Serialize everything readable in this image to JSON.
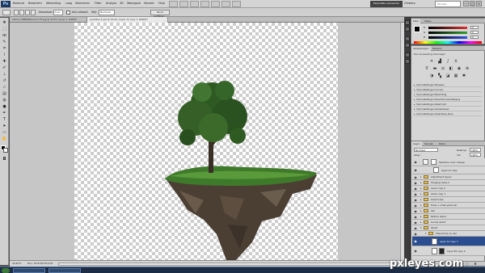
{
  "app": {
    "logo": "Ps"
  },
  "menubar": {
    "items": [
      "Bestand",
      "Bewerken",
      "Afbeelding",
      "Laag",
      "Selecteren",
      "Filter",
      "Analyse",
      "3D",
      "Weergave",
      "Venster",
      "Help"
    ],
    "workspace_button": "Essentiële elementen",
    "workspace_label": "Ontwerp",
    "search_placeholder": "CS Live"
  },
  "options_bar": {
    "feather_label": "Doezelaar:",
    "feather_value": "0 px",
    "antialias_label": "Anti-aliased",
    "style_label": "Stijl:",
    "style_value": "Normaal",
    "refine_button": "Rand verfijnen..."
  },
  "doc_tabs": [
    {
      "label": "ehland_388688/byns-III-75.jpg @ 34,3% (Layer 1, RGB/8)",
      "active": false
    },
    {
      "label": "pixeltiles-3.psd @ 16,6% (Layer 14 copy 7, RGB/8*)",
      "active": true
    }
  ],
  "status": {
    "zoom": "16,67%",
    "doc": "Doc: 43,8 M/133,9 M"
  },
  "color_panel": {
    "tabs": [
      "Kleur",
      "Stalen"
    ],
    "sliders": [
      {
        "label": "R",
        "value": "0",
        "color": "#e03030"
      },
      {
        "label": "G",
        "value": "0",
        "color": "#30a030"
      },
      {
        "label": "B",
        "value": "0",
        "color": "#3050e0"
      }
    ]
  },
  "adjustments_panel": {
    "tabs": [
      "Aanpassingen",
      "Maskers"
    ],
    "heading": "Een aanpassing toevoegen",
    "icons_row1": [
      "brightness-icon",
      "levels-icon",
      "curves-icon",
      "exposure-icon"
    ],
    "icons_row2": [
      "vibrance-icon",
      "hue-icon",
      "balance-icon",
      "bw-icon",
      "photo-filter-icon",
      "mixer-icon"
    ],
    "icons_row3": [
      "invert-icon",
      "posterize-icon",
      "threshold-icon",
      "gradient-map-icon",
      "selective-color-icon"
    ],
    "presets": [
      "Voorinstellingen Niveaus",
      "Voorinstellingen Curven",
      "Voorinstellingen Belichting",
      "Voorinstellingen Kleurtoon/verzadiging",
      "Voorinstellingen Zwart-wit",
      "Voorinstellingen Kanaalmixer",
      "Voorinstellingen Selectieve kleur"
    ]
  },
  "layers_panel": {
    "tabs": [
      "Lagen",
      "Kanalen",
      "Paden"
    ],
    "blend_mode": "Normaal",
    "opacity_label": "Dekking:",
    "opacity_value": "100%",
    "lock_label": "Vergr.:",
    "fill_label": "Vul:",
    "fill_value": "100%",
    "layers": [
      {
        "name": "Selective color change",
        "type": "adjustment",
        "selected": false
      },
      {
        "name": "Layer 41 copy",
        "type": "layer",
        "selected": false
      },
      {
        "name": "Adjustment layers",
        "type": "group",
        "selected": false
      },
      {
        "name": "Hanging ropes 2",
        "type": "group",
        "selected": false
      },
      {
        "name": "Lamp copy 2",
        "type": "group",
        "selected": false
      },
      {
        "name": "Lamp copy 1",
        "type": "group",
        "selected": false
      },
      {
        "name": "Giant trees",
        "type": "group",
        "selected": false
      },
      {
        "name": "Trees + small grass etc",
        "type": "group",
        "selected": false
      },
      {
        "name": "Isle",
        "type": "group",
        "selected": false
      },
      {
        "name": "Mother island",
        "type": "group",
        "selected": false
      },
      {
        "name": "Lonely island",
        "type": "group",
        "selected": false
      },
      {
        "name": "Island",
        "type": "group",
        "selected": false
      },
      {
        "name": "Shaved top on isle",
        "type": "group",
        "selected": false
      },
      {
        "name": "Layer 14 copy 7",
        "type": "layer",
        "selected": true
      },
      {
        "name": "Layer 65 copy 4",
        "type": "layer",
        "selected": false
      }
    ]
  },
  "watermark": "pxleyes.com"
}
